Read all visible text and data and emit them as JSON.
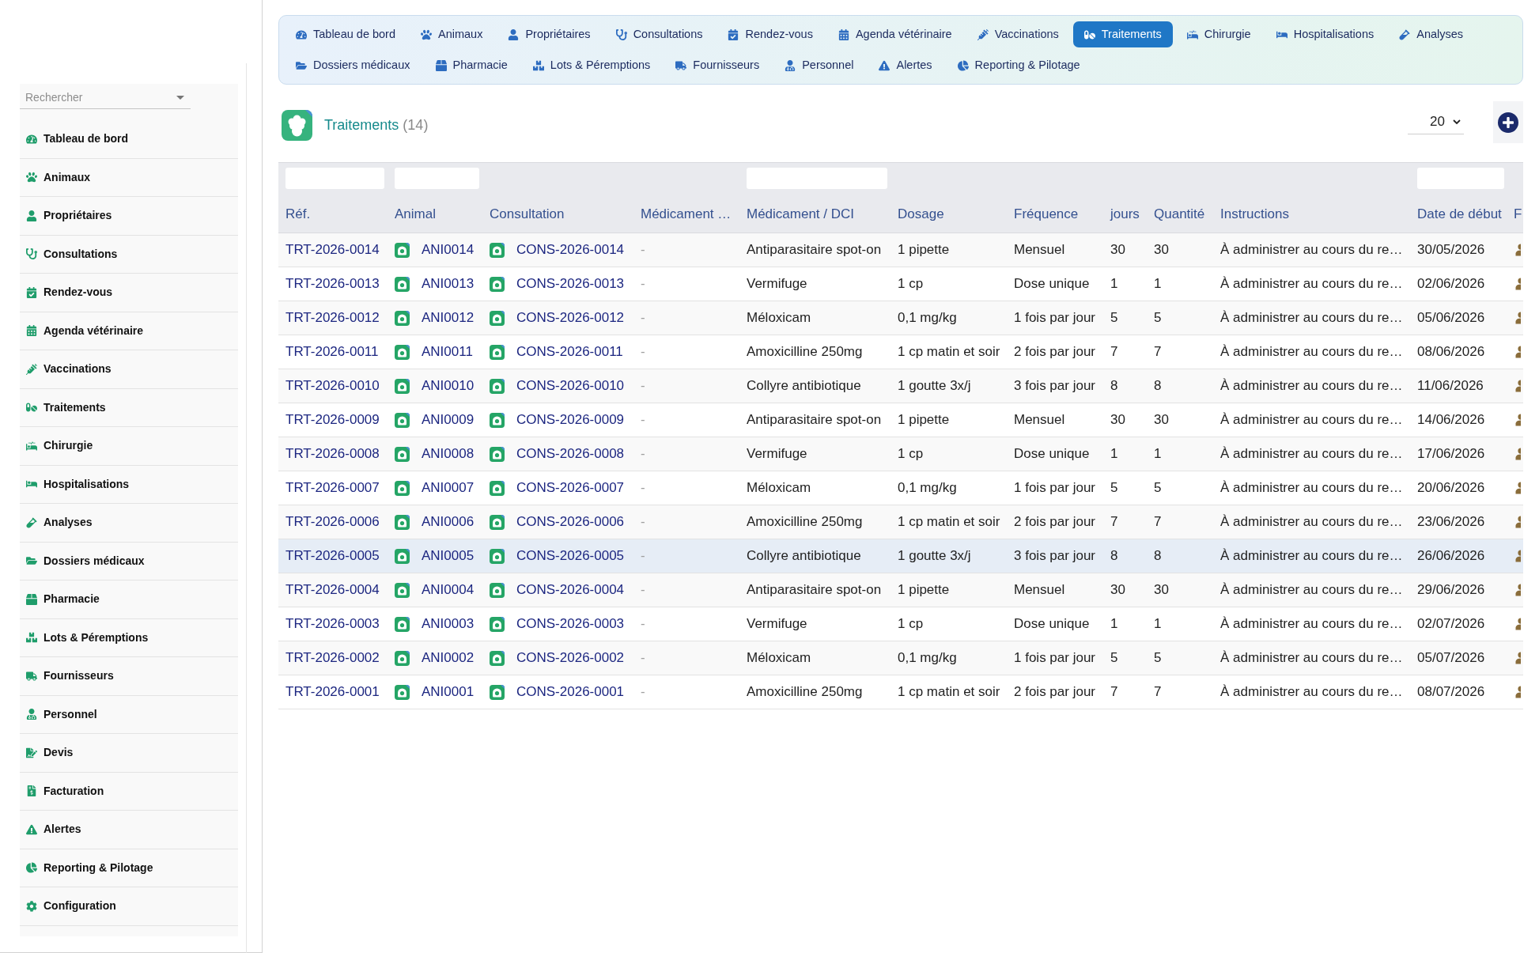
{
  "sidebar": {
    "search": {
      "placeholder": "Rechercher"
    },
    "items": [
      {
        "label": "Tableau de bord",
        "selected": false
      },
      {
        "label": "Animaux",
        "selected": false
      },
      {
        "label": "Propriétaires",
        "selected": false
      },
      {
        "label": "Consultations",
        "selected": false
      },
      {
        "label": "Rendez-vous",
        "selected": false
      },
      {
        "label": "Agenda vétérinaire",
        "selected": false
      },
      {
        "label": "Vaccinations",
        "selected": false
      },
      {
        "label": "Traitements",
        "selected": false
      },
      {
        "label": "Chirurgie",
        "selected": false
      },
      {
        "label": "Hospitalisations",
        "selected": false
      },
      {
        "label": "Analyses",
        "selected": false
      },
      {
        "label": "Dossiers médicaux",
        "selected": false
      },
      {
        "label": "Pharmacie",
        "selected": false
      },
      {
        "label": "Lots & Péremptions",
        "selected": false
      },
      {
        "label": "Fournisseurs",
        "selected": false
      },
      {
        "label": "Personnel",
        "selected": false
      },
      {
        "label": "Devis",
        "selected": false
      },
      {
        "label": "Facturation",
        "selected": false
      },
      {
        "label": "Alertes",
        "selected": false
      },
      {
        "label": "Reporting & Pilotage",
        "selected": false
      },
      {
        "label": "Configuration",
        "selected": false
      }
    ]
  },
  "nav": {
    "tabs": [
      {
        "label": "Tableau de bord",
        "selected": false
      },
      {
        "label": "Animaux",
        "selected": false
      },
      {
        "label": "Propriétaires",
        "selected": false
      },
      {
        "label": "Consultations",
        "selected": false
      },
      {
        "label": "Rendez-vous",
        "selected": false
      },
      {
        "label": "Agenda vétérinaire",
        "selected": false
      },
      {
        "label": "Vaccinations",
        "selected": false
      },
      {
        "label": "Traitements",
        "selected": true
      },
      {
        "label": "Chirurgie",
        "selected": false
      },
      {
        "label": "Hospitalisations",
        "selected": false
      },
      {
        "label": "Analyses",
        "selected": false
      },
      {
        "label": "Dossiers médicaux",
        "selected": false
      },
      {
        "label": "Pharmacie",
        "selected": false
      },
      {
        "label": "Lots & Péremptions",
        "selected": false
      },
      {
        "label": "Fournisseurs",
        "selected": false
      },
      {
        "label": "Personnel",
        "selected": false
      },
      {
        "label": "Alertes",
        "selected": false
      },
      {
        "label": "Reporting & Pilotage",
        "selected": false
      }
    ]
  },
  "header": {
    "title": "Traitements",
    "count": "(14)",
    "page_size": "20"
  },
  "table": {
    "columns": [
      {
        "label": "Réf.",
        "filter": true
      },
      {
        "label": "Animal",
        "filter": true
      },
      {
        "label": "Consultation",
        "filter": false
      },
      {
        "label": "Médicament …",
        "filter": false
      },
      {
        "label": "Médicament / DCI",
        "filter": true
      },
      {
        "label": "Dosage",
        "filter": false
      },
      {
        "label": "Fréquence",
        "filter": false
      },
      {
        "label": "jours",
        "filter": false
      },
      {
        "label": "Quantité",
        "filter": false
      },
      {
        "label": "Instructions",
        "filter": false
      },
      {
        "label": "Date de début",
        "filter": true
      },
      {
        "label": "F",
        "filter": false
      }
    ],
    "rows": [
      {
        "ref": "TRT-2026-0014",
        "animal": "ANI0014",
        "consultation": "CONS-2026-0014",
        "medicament": "-",
        "medicament_dci": "Antiparasitaire spot-on",
        "dosage": "1 pipette",
        "frequence": "Mensuel",
        "jours": "30",
        "quantite": "30",
        "instructions": "À administrer au cours du re…",
        "date_debut": "30/05/2026",
        "selected": false
      },
      {
        "ref": "TRT-2026-0013",
        "animal": "ANI0013",
        "consultation": "CONS-2026-0013",
        "medicament": "-",
        "medicament_dci": "Vermifuge",
        "dosage": "1 cp",
        "frequence": "Dose unique",
        "jours": "1",
        "quantite": "1",
        "instructions": "À administrer au cours du re…",
        "date_debut": "02/06/2026",
        "selected": false
      },
      {
        "ref": "TRT-2026-0012",
        "animal": "ANI0012",
        "consultation": "CONS-2026-0012",
        "medicament": "-",
        "medicament_dci": "Méloxicam",
        "dosage": "0,1 mg/kg",
        "frequence": "1 fois par jour",
        "jours": "5",
        "quantite": "5",
        "instructions": "À administrer au cours du re…",
        "date_debut": "05/06/2026",
        "selected": false
      },
      {
        "ref": "TRT-2026-0011",
        "animal": "ANI0011",
        "consultation": "CONS-2026-0011",
        "medicament": "-",
        "medicament_dci": "Amoxicilline 250mg",
        "dosage": "1 cp matin et soir",
        "frequence": "2 fois par jour",
        "jours": "7",
        "quantite": "7",
        "instructions": "À administrer au cours du re…",
        "date_debut": "08/06/2026",
        "selected": false
      },
      {
        "ref": "TRT-2026-0010",
        "animal": "ANI0010",
        "consultation": "CONS-2026-0010",
        "medicament": "-",
        "medicament_dci": "Collyre antibiotique",
        "dosage": "1 goutte 3x/j",
        "frequence": "3 fois par jour",
        "jours": "8",
        "quantite": "8",
        "instructions": "À administrer au cours du re…",
        "date_debut": "11/06/2026",
        "selected": false
      },
      {
        "ref": "TRT-2026-0009",
        "animal": "ANI0009",
        "consultation": "CONS-2026-0009",
        "medicament": "-",
        "medicament_dci": "Antiparasitaire spot-on",
        "dosage": "1 pipette",
        "frequence": "Mensuel",
        "jours": "30",
        "quantite": "30",
        "instructions": "À administrer au cours du re…",
        "date_debut": "14/06/2026",
        "selected": false
      },
      {
        "ref": "TRT-2026-0008",
        "animal": "ANI0008",
        "consultation": "CONS-2026-0008",
        "medicament": "-",
        "medicament_dci": "Vermifuge",
        "dosage": "1 cp",
        "frequence": "Dose unique",
        "jours": "1",
        "quantite": "1",
        "instructions": "À administrer au cours du re…",
        "date_debut": "17/06/2026",
        "selected": false
      },
      {
        "ref": "TRT-2026-0007",
        "animal": "ANI0007",
        "consultation": "CONS-2026-0007",
        "medicament": "-",
        "medicament_dci": "Méloxicam",
        "dosage": "0,1 mg/kg",
        "frequence": "1 fois par jour",
        "jours": "5",
        "quantite": "5",
        "instructions": "À administrer au cours du re…",
        "date_debut": "20/06/2026",
        "selected": false
      },
      {
        "ref": "TRT-2026-0006",
        "animal": "ANI0006",
        "consultation": "CONS-2026-0006",
        "medicament": "-",
        "medicament_dci": "Amoxicilline 250mg",
        "dosage": "1 cp matin et soir",
        "frequence": "2 fois par jour",
        "jours": "7",
        "quantite": "7",
        "instructions": "À administrer au cours du re…",
        "date_debut": "23/06/2026",
        "selected": false
      },
      {
        "ref": "TRT-2026-0005",
        "animal": "ANI0005",
        "consultation": "CONS-2026-0005",
        "medicament": "-",
        "medicament_dci": "Collyre antibiotique",
        "dosage": "1 goutte 3x/j",
        "frequence": "3 fois par jour",
        "jours": "8",
        "quantite": "8",
        "instructions": "À administrer au cours du re…",
        "date_debut": "26/06/2026",
        "selected": true
      },
      {
        "ref": "TRT-2026-0004",
        "animal": "ANI0004",
        "consultation": "CONS-2026-0004",
        "medicament": "-",
        "medicament_dci": "Antiparasitaire spot-on",
        "dosage": "1 pipette",
        "frequence": "Mensuel",
        "jours": "30",
        "quantite": "30",
        "instructions": "À administrer au cours du re…",
        "date_debut": "29/06/2026",
        "selected": false
      },
      {
        "ref": "TRT-2026-0003",
        "animal": "ANI0003",
        "consultation": "CONS-2026-0003",
        "medicament": "-",
        "medicament_dci": "Vermifuge",
        "dosage": "1 cp",
        "frequence": "Dose unique",
        "jours": "1",
        "quantite": "1",
        "instructions": "À administrer au cours du re…",
        "date_debut": "02/07/2026",
        "selected": false
      },
      {
        "ref": "TRT-2026-0002",
        "animal": "ANI0002",
        "consultation": "CONS-2026-0002",
        "medicament": "-",
        "medicament_dci": "Méloxicam",
        "dosage": "0,1 mg/kg",
        "frequence": "1 fois par jour",
        "jours": "5",
        "quantite": "5",
        "instructions": "À administrer au cours du re…",
        "date_debut": "05/07/2026",
        "selected": false
      },
      {
        "ref": "TRT-2026-0001",
        "animal": "ANI0001",
        "consultation": "CONS-2026-0001",
        "medicament": "-",
        "medicament_dci": "Amoxicilline 250mg",
        "dosage": "1 cp matin et soir",
        "frequence": "2 fois par jour",
        "jours": "7",
        "quantite": "7",
        "instructions": "À administrer au cours du re…",
        "date_debut": "08/07/2026",
        "selected": false
      }
    ]
  }
}
